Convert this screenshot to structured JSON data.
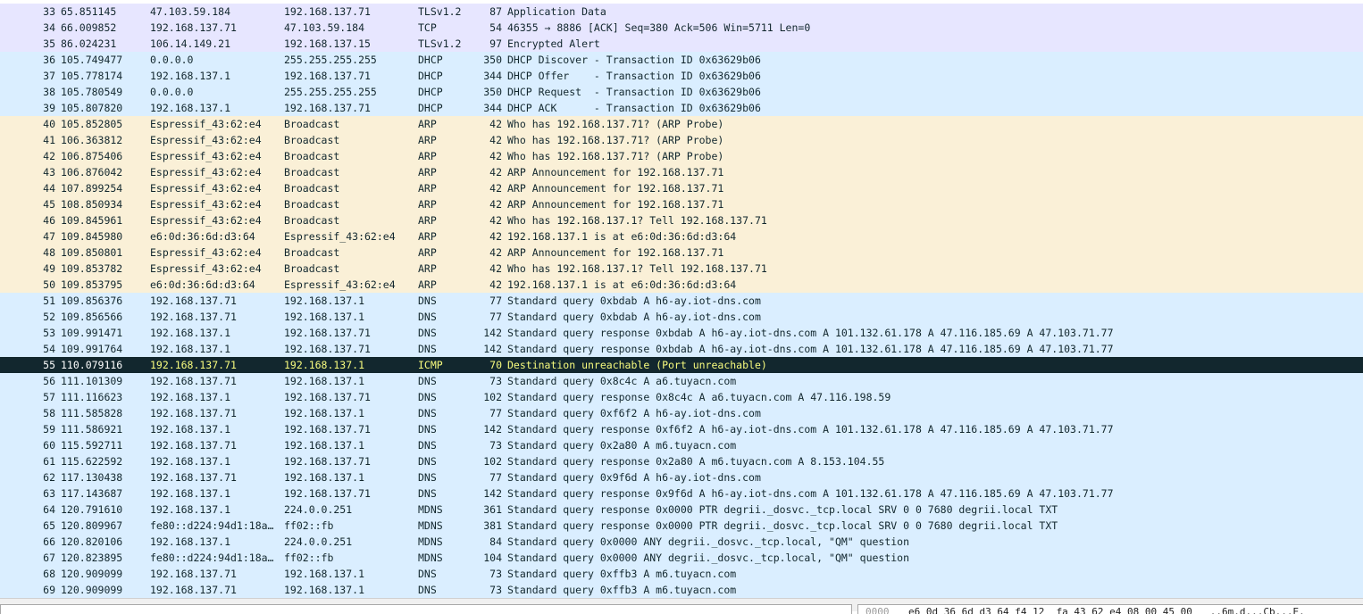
{
  "colors": {
    "tls": "#e7e6ff",
    "tcp": "#e7e6ff",
    "dhcp": "#daeeff",
    "arp": "#faf0d7",
    "dns": "#daeeff",
    "mdns": "#daeeff",
    "icmp_selected": "#12272e"
  },
  "packets": [
    {
      "no": "33",
      "time": "65.851145",
      "src": "47.103.59.184",
      "dst": "192.168.137.71",
      "proto": "TLSv1.2",
      "len": "87",
      "info": "Application Data",
      "color": "#e7e6ff"
    },
    {
      "no": "34",
      "time": "66.009852",
      "src": "192.168.137.71",
      "dst": "47.103.59.184",
      "proto": "TCP",
      "len": "54",
      "info": "46355 → 8886 [ACK] Seq=380 Ack=506 Win=5711 Len=0",
      "color": "#e7e6ff"
    },
    {
      "no": "35",
      "time": "86.024231",
      "src": "106.14.149.21",
      "dst": "192.168.137.15",
      "proto": "TLSv1.2",
      "len": "97",
      "info": "Encrypted Alert",
      "color": "#e7e6ff"
    },
    {
      "no": "36",
      "time": "105.749477",
      "src": "0.0.0.0",
      "dst": "255.255.255.255",
      "proto": "DHCP",
      "len": "350",
      "info": "DHCP Discover - Transaction ID 0x63629b06",
      "color": "#daeeff"
    },
    {
      "no": "37",
      "time": "105.778174",
      "src": "192.168.137.1",
      "dst": "192.168.137.71",
      "proto": "DHCP",
      "len": "344",
      "info": "DHCP Offer    - Transaction ID 0x63629b06",
      "color": "#daeeff"
    },
    {
      "no": "38",
      "time": "105.780549",
      "src": "0.0.0.0",
      "dst": "255.255.255.255",
      "proto": "DHCP",
      "len": "350",
      "info": "DHCP Request  - Transaction ID 0x63629b06",
      "color": "#daeeff"
    },
    {
      "no": "39",
      "time": "105.807820",
      "src": "192.168.137.1",
      "dst": "192.168.137.71",
      "proto": "DHCP",
      "len": "344",
      "info": "DHCP ACK      - Transaction ID 0x63629b06",
      "color": "#daeeff"
    },
    {
      "no": "40",
      "time": "105.852805",
      "src": "Espressif_43:62:e4",
      "dst": "Broadcast",
      "proto": "ARP",
      "len": "42",
      "info": "Who has 192.168.137.71? (ARP Probe)",
      "color": "#faf0d7"
    },
    {
      "no": "41",
      "time": "106.363812",
      "src": "Espressif_43:62:e4",
      "dst": "Broadcast",
      "proto": "ARP",
      "len": "42",
      "info": "Who has 192.168.137.71? (ARP Probe)",
      "color": "#faf0d7"
    },
    {
      "no": "42",
      "time": "106.875406",
      "src": "Espressif_43:62:e4",
      "dst": "Broadcast",
      "proto": "ARP",
      "len": "42",
      "info": "Who has 192.168.137.71? (ARP Probe)",
      "color": "#faf0d7"
    },
    {
      "no": "43",
      "time": "106.876042",
      "src": "Espressif_43:62:e4",
      "dst": "Broadcast",
      "proto": "ARP",
      "len": "42",
      "info": "ARP Announcement for 192.168.137.71",
      "color": "#faf0d7"
    },
    {
      "no": "44",
      "time": "107.899254",
      "src": "Espressif_43:62:e4",
      "dst": "Broadcast",
      "proto": "ARP",
      "len": "42",
      "info": "ARP Announcement for 192.168.137.71",
      "color": "#faf0d7"
    },
    {
      "no": "45",
      "time": "108.850934",
      "src": "Espressif_43:62:e4",
      "dst": "Broadcast",
      "proto": "ARP",
      "len": "42",
      "info": "ARP Announcement for 192.168.137.71",
      "color": "#faf0d7"
    },
    {
      "no": "46",
      "time": "109.845961",
      "src": "Espressif_43:62:e4",
      "dst": "Broadcast",
      "proto": "ARP",
      "len": "42",
      "info": "Who has 192.168.137.1? Tell 192.168.137.71",
      "color": "#faf0d7"
    },
    {
      "no": "47",
      "time": "109.845980",
      "src": "e6:0d:36:6d:d3:64",
      "dst": "Espressif_43:62:e4",
      "proto": "ARP",
      "len": "42",
      "info": "192.168.137.1 is at e6:0d:36:6d:d3:64",
      "color": "#faf0d7"
    },
    {
      "no": "48",
      "time": "109.850801",
      "src": "Espressif_43:62:e4",
      "dst": "Broadcast",
      "proto": "ARP",
      "len": "42",
      "info": "ARP Announcement for 192.168.137.71",
      "color": "#faf0d7"
    },
    {
      "no": "49",
      "time": "109.853782",
      "src": "Espressif_43:62:e4",
      "dst": "Broadcast",
      "proto": "ARP",
      "len": "42",
      "info": "Who has 192.168.137.1? Tell 192.168.137.71",
      "color": "#faf0d7"
    },
    {
      "no": "50",
      "time": "109.853795",
      "src": "e6:0d:36:6d:d3:64",
      "dst": "Espressif_43:62:e4",
      "proto": "ARP",
      "len": "42",
      "info": "192.168.137.1 is at e6:0d:36:6d:d3:64",
      "color": "#faf0d7"
    },
    {
      "no": "51",
      "time": "109.856376",
      "src": "192.168.137.71",
      "dst": "192.168.137.1",
      "proto": "DNS",
      "len": "77",
      "info": "Standard query 0xbdab A h6-ay.iot-dns.com",
      "color": "#daeeff"
    },
    {
      "no": "52",
      "time": "109.856566",
      "src": "192.168.137.71",
      "dst": "192.168.137.1",
      "proto": "DNS",
      "len": "77",
      "info": "Standard query 0xbdab A h6-ay.iot-dns.com",
      "color": "#daeeff"
    },
    {
      "no": "53",
      "time": "109.991471",
      "src": "192.168.137.1",
      "dst": "192.168.137.71",
      "proto": "DNS",
      "len": "142",
      "info": "Standard query response 0xbdab A h6-ay.iot-dns.com A 101.132.61.178 A 47.116.185.69 A 47.103.71.77",
      "color": "#daeeff"
    },
    {
      "no": "54",
      "time": "109.991764",
      "src": "192.168.137.1",
      "dst": "192.168.137.71",
      "proto": "DNS",
      "len": "142",
      "info": "Standard query response 0xbdab A h6-ay.iot-dns.com A 101.132.61.178 A 47.116.185.69 A 47.103.71.77",
      "color": "#daeeff"
    },
    {
      "no": "55",
      "time": "110.079116",
      "src": "192.168.137.71",
      "dst": "192.168.137.1",
      "proto": "ICMP",
      "len": "70",
      "info": "Destination unreachable (Port unreachable)",
      "color": "#12272e",
      "selected": true
    },
    {
      "no": "56",
      "time": "111.101309",
      "src": "192.168.137.71",
      "dst": "192.168.137.1",
      "proto": "DNS",
      "len": "73",
      "info": "Standard query 0x8c4c A a6.tuyacn.com",
      "color": "#daeeff"
    },
    {
      "no": "57",
      "time": "111.116623",
      "src": "192.168.137.1",
      "dst": "192.168.137.71",
      "proto": "DNS",
      "len": "102",
      "info": "Standard query response 0x8c4c A a6.tuyacn.com A 47.116.198.59",
      "color": "#daeeff"
    },
    {
      "no": "58",
      "time": "111.585828",
      "src": "192.168.137.71",
      "dst": "192.168.137.1",
      "proto": "DNS",
      "len": "77",
      "info": "Standard query 0xf6f2 A h6-ay.iot-dns.com",
      "color": "#daeeff"
    },
    {
      "no": "59",
      "time": "111.586921",
      "src": "192.168.137.1",
      "dst": "192.168.137.71",
      "proto": "DNS",
      "len": "142",
      "info": "Standard query response 0xf6f2 A h6-ay.iot-dns.com A 101.132.61.178 A 47.116.185.69 A 47.103.71.77",
      "color": "#daeeff"
    },
    {
      "no": "60",
      "time": "115.592711",
      "src": "192.168.137.71",
      "dst": "192.168.137.1",
      "proto": "DNS",
      "len": "73",
      "info": "Standard query 0x2a80 A m6.tuyacn.com",
      "color": "#daeeff"
    },
    {
      "no": "61",
      "time": "115.622592",
      "src": "192.168.137.1",
      "dst": "192.168.137.71",
      "proto": "DNS",
      "len": "102",
      "info": "Standard query response 0x2a80 A m6.tuyacn.com A 8.153.104.55",
      "color": "#daeeff"
    },
    {
      "no": "62",
      "time": "117.130438",
      "src": "192.168.137.71",
      "dst": "192.168.137.1",
      "proto": "DNS",
      "len": "77",
      "info": "Standard query 0x9f6d A h6-ay.iot-dns.com",
      "color": "#daeeff"
    },
    {
      "no": "63",
      "time": "117.143687",
      "src": "192.168.137.1",
      "dst": "192.168.137.71",
      "proto": "DNS",
      "len": "142",
      "info": "Standard query response 0x9f6d A h6-ay.iot-dns.com A 101.132.61.178 A 47.116.185.69 A 47.103.71.77",
      "color": "#daeeff"
    },
    {
      "no": "64",
      "time": "120.791610",
      "src": "192.168.137.1",
      "dst": "224.0.0.251",
      "proto": "MDNS",
      "len": "361",
      "info": "Standard query response 0x0000 PTR degrii._dosvc._tcp.local SRV 0 0 7680 degrii.local TXT",
      "color": "#daeeff"
    },
    {
      "no": "65",
      "time": "120.809967",
      "src": "fe80::d224:94d1:18a…",
      "dst": "ff02::fb",
      "proto": "MDNS",
      "len": "381",
      "info": "Standard query response 0x0000 PTR degrii._dosvc._tcp.local SRV 0 0 7680 degrii.local TXT",
      "color": "#daeeff"
    },
    {
      "no": "66",
      "time": "120.820106",
      "src": "192.168.137.1",
      "dst": "224.0.0.251",
      "proto": "MDNS",
      "len": "84",
      "info": "Standard query 0x0000 ANY degrii._dosvc._tcp.local, \"QM\" question",
      "color": "#daeeff"
    },
    {
      "no": "67",
      "time": "120.823895",
      "src": "fe80::d224:94d1:18a…",
      "dst": "ff02::fb",
      "proto": "MDNS",
      "len": "104",
      "info": "Standard query 0x0000 ANY degrii._dosvc._tcp.local, \"QM\" question",
      "color": "#daeeff"
    },
    {
      "no": "68",
      "time": "120.909099",
      "src": "192.168.137.71",
      "dst": "192.168.137.1",
      "proto": "DNS",
      "len": "73",
      "info": "Standard query 0xffb3 A m6.tuyacn.com",
      "color": "#daeeff"
    },
    {
      "no": "69",
      "time": "120.909099",
      "src": "192.168.137.71",
      "dst": "192.168.137.1",
      "proto": "DNS",
      "len": "73",
      "info": "Standard query 0xffb3 A m6.tuyacn.com",
      "color": "#daeeff"
    }
  ],
  "bytes_pane": {
    "offset": "0000",
    "hex": "e6 0d 36 6d d3 64 f4 12  fa 43 62 e4 08 00 45 00   ..6m.d...Cb...E."
  }
}
